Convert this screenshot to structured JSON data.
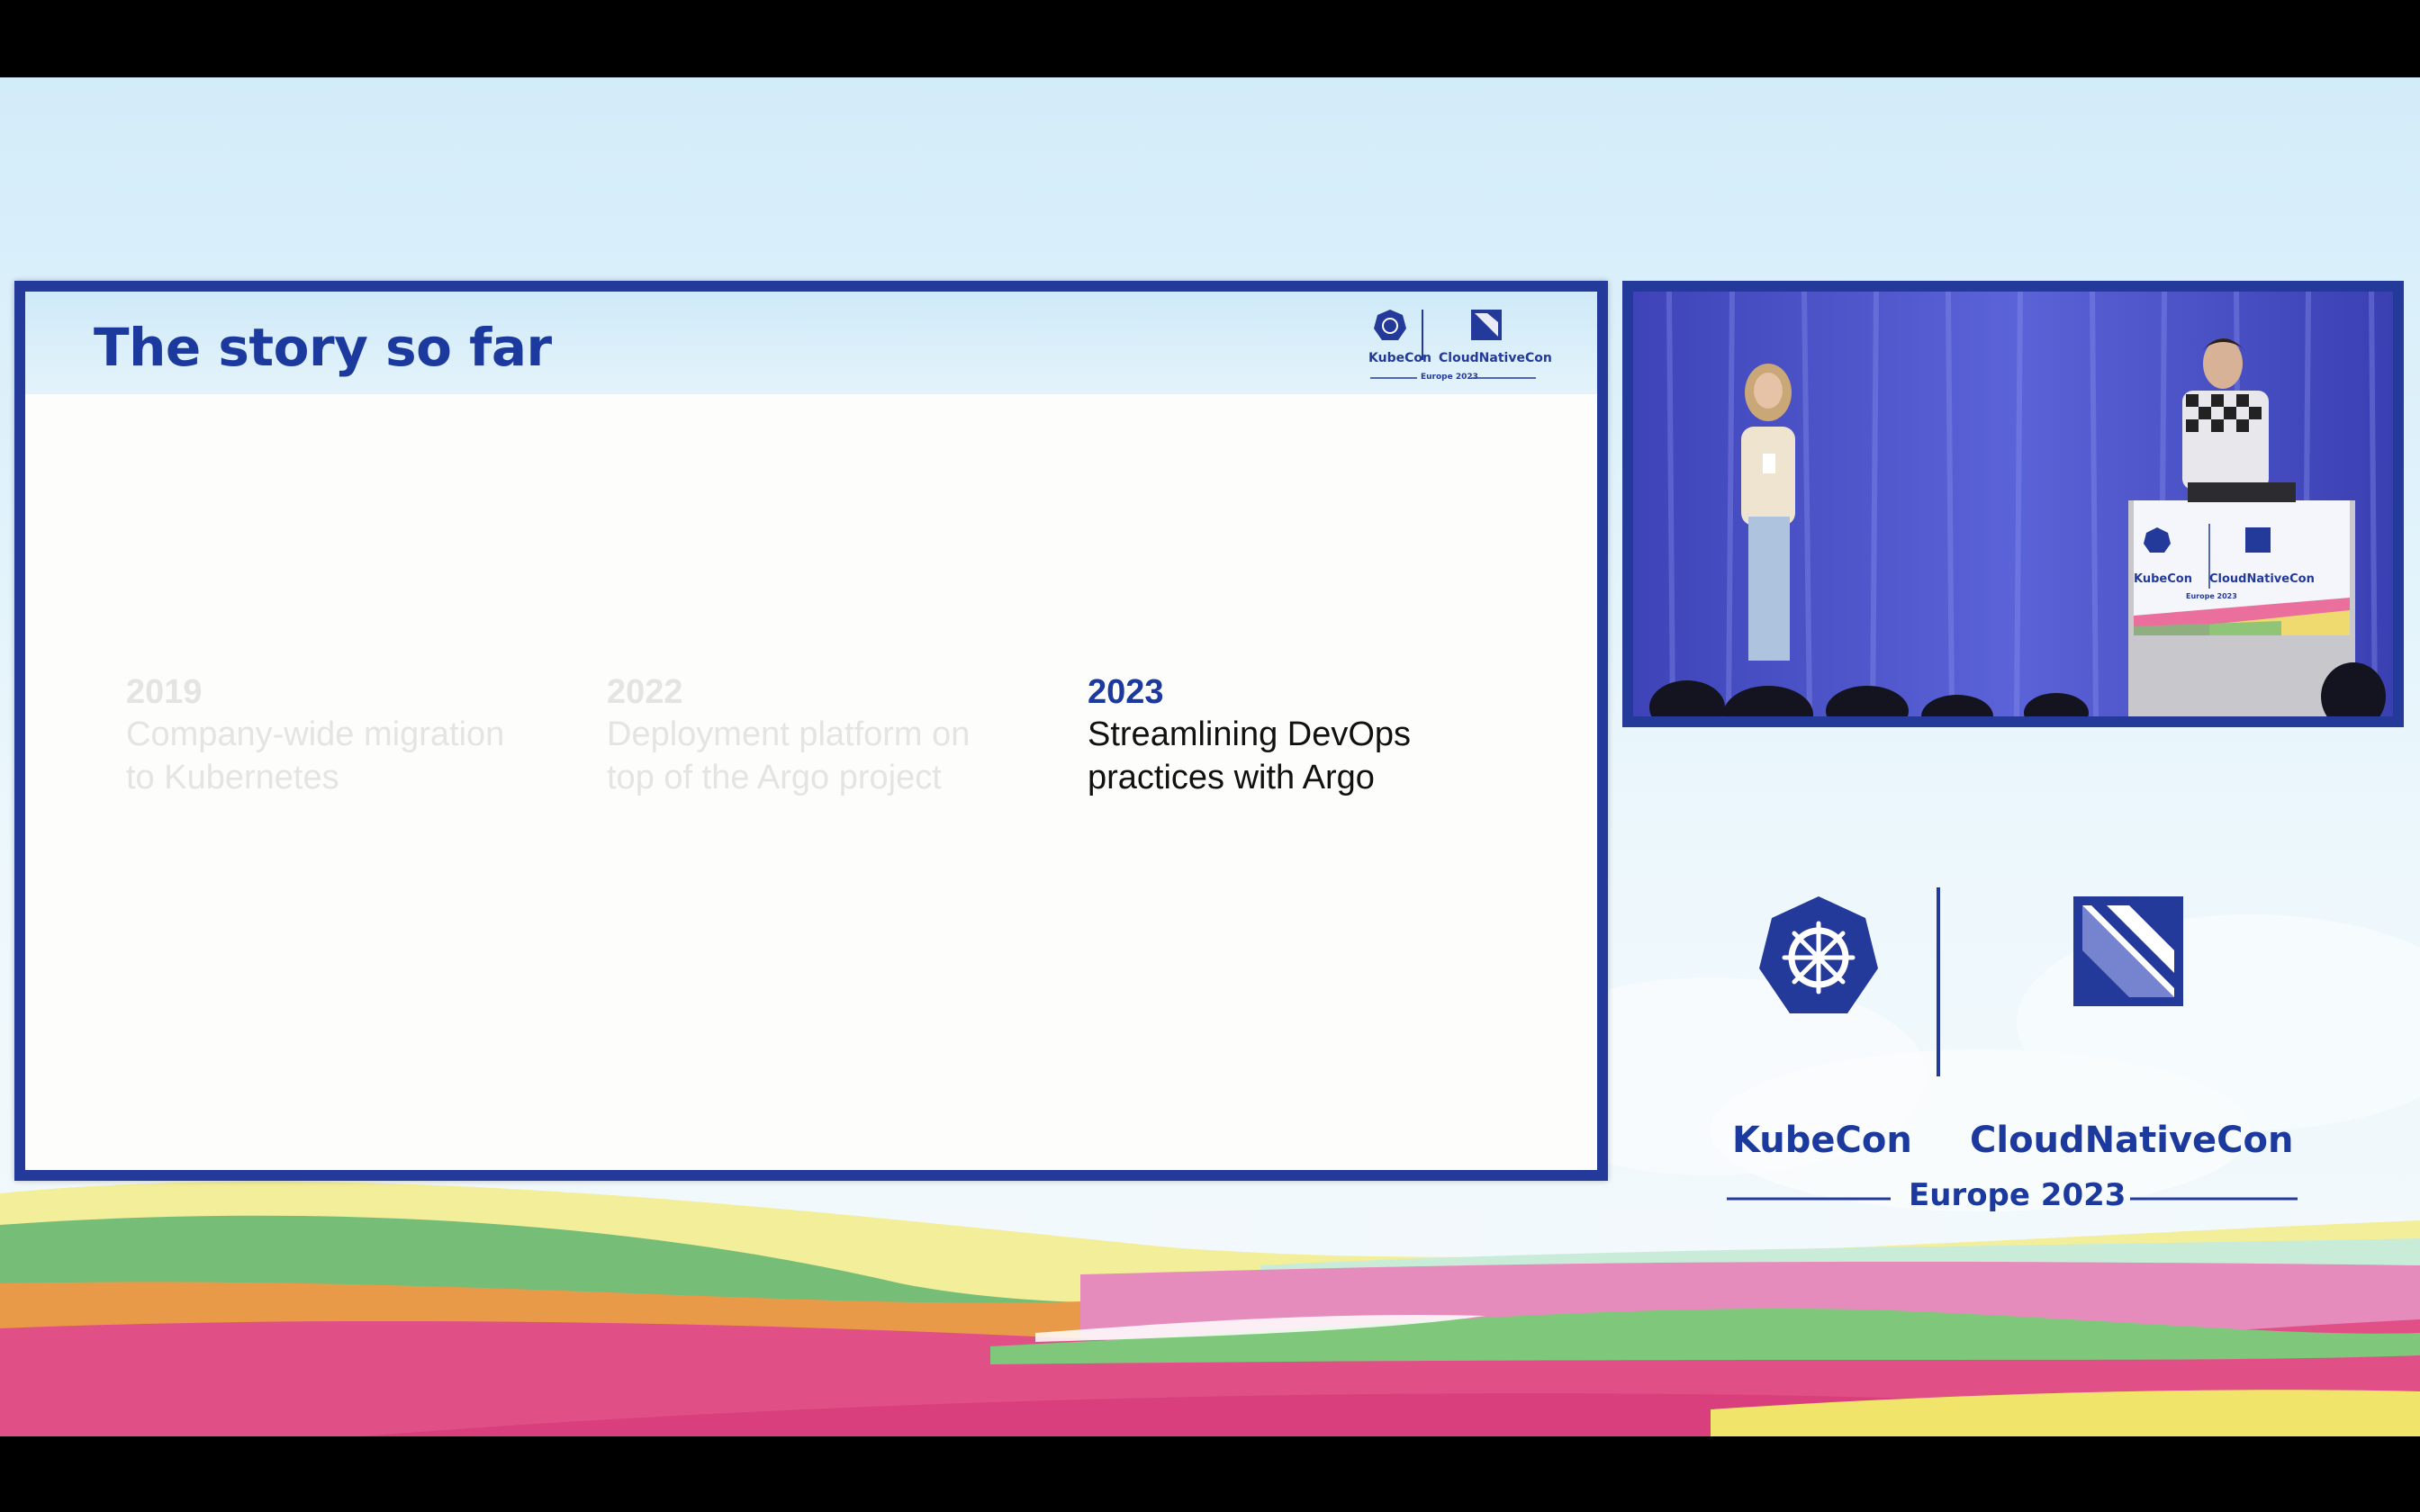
{
  "slide": {
    "title": "The story so far",
    "timeline": [
      {
        "year": "2019",
        "lines": [
          "Company-wide migration",
          "to Kubernetes"
        ],
        "state": "faded"
      },
      {
        "year": "2022",
        "lines": [
          "Deployment platform on",
          "top of the Argo project"
        ],
        "state": "faded"
      },
      {
        "year": "2023",
        "lines": [
          "Streamlining DevOps",
          "practices with Argo"
        ],
        "state": "active"
      }
    ],
    "mini_logo": {
      "left": "KubeCon",
      "right": "CloudNativeCon",
      "sub": "Europe 2023"
    }
  },
  "branding": {
    "left": "KubeCon",
    "right": "CloudNativeCon",
    "sub": "Europe 2023"
  },
  "podium": {
    "left": "KubeCon",
    "right": "CloudNativeCon",
    "sub": "Europe 2023"
  },
  "colors": {
    "brand_blue": "#233a9b",
    "title_blue": "#1c3a9e",
    "faded_text": "#e4e4e4"
  }
}
